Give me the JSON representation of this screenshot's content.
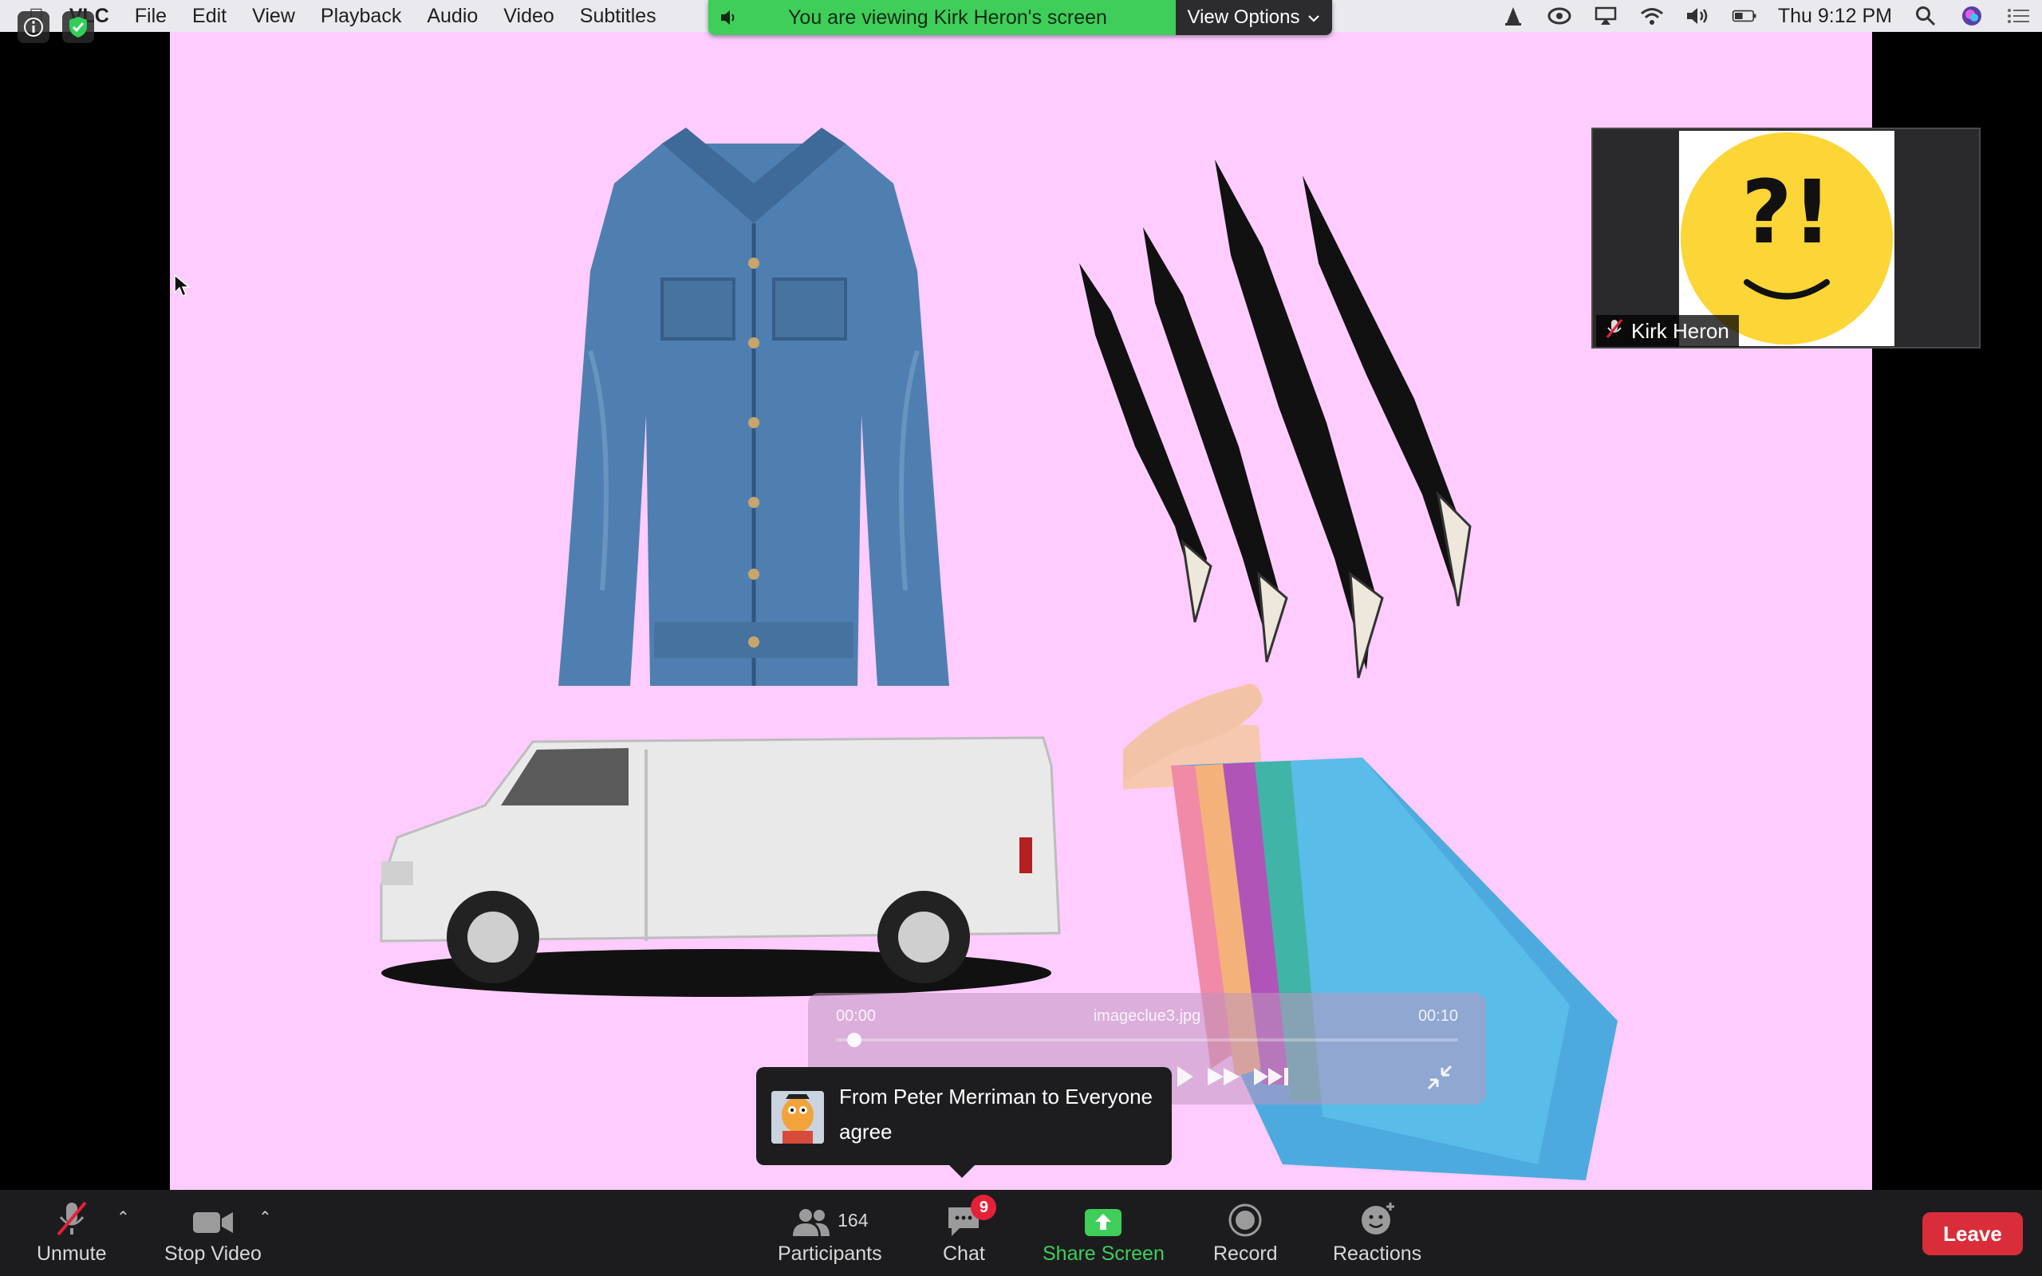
{
  "menubar": {
    "app_name": "VLC",
    "items": [
      "File",
      "Edit",
      "View",
      "Playback",
      "Audio",
      "Video",
      "Subtitles"
    ],
    "clock": "Thu 9:12 PM"
  },
  "share_banner": {
    "text": "You are viewing Kirk Heron's screen",
    "options_label": "View Options"
  },
  "thumbnail": {
    "name": "Kirk Heron",
    "avatar_text": "?!"
  },
  "player": {
    "time_start": "00:00",
    "file_name": "imageclue3.jpg",
    "time_end": "00:10",
    "progress": 0.03
  },
  "chat_toast": {
    "from": "From Peter Merriman to Everyone",
    "message": "agree"
  },
  "toolbar": {
    "unmute": "Unmute",
    "stop_video": "Stop Video",
    "participants": "Participants",
    "participants_count": "164",
    "chat": "Chat",
    "chat_badge": "9",
    "share_screen": "Share Screen",
    "record": "Record",
    "reactions": "Reactions",
    "leave": "Leave"
  },
  "colors": {
    "banner_green": "#3fce5a",
    "share_green": "#3fce5a",
    "leave_red": "#d92d3a",
    "slide_bg": "#ffccff",
    "avatar_yellow": "#fcd536"
  }
}
